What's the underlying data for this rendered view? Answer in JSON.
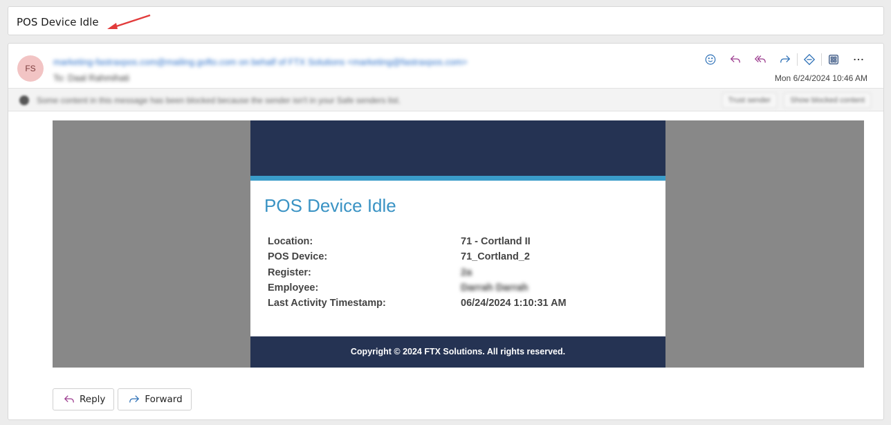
{
  "subject": "POS Device Idle",
  "message": {
    "avatar_initials": "FS",
    "sender": "marketing-fastraxpos.com@mailing.gofto.com on behalf of FTX Solutions <marketing@fastraxpos.com>",
    "to": "To: Daal Rahmihati",
    "date": "Mon 6/24/2024 10:46 AM",
    "actions": [
      "emoji-icon",
      "reply-icon",
      "reply-all-icon",
      "forward-icon",
      "immersive-reader-icon",
      "apps-icon",
      "more-icon"
    ]
  },
  "blocked_bar": {
    "text": "Some content in this message has been blocked because the sender isn't in your Safe senders list.",
    "trust_label": "Trust sender",
    "show_label": "Show blocked content"
  },
  "email": {
    "title": "POS Device Idle",
    "rows": [
      {
        "label": "Location:",
        "value": "71 - Cortland II",
        "redacted": false
      },
      {
        "label": "POS Device:",
        "value": "71_Cortland_2",
        "redacted": false
      },
      {
        "label": "Register:",
        "value": "2a",
        "redacted": true
      },
      {
        "label": "Employee:",
        "value": "Darrah Darrah",
        "redacted": true
      },
      {
        "label": "Last Activity Timestamp:",
        "value": "06/24/2024 1:10:31 AM",
        "redacted": false
      }
    ],
    "footer": "Copyright © 2024 FTX Solutions. All rights reserved."
  },
  "buttons": {
    "reply": "Reply",
    "forward": "Forward"
  },
  "colors": {
    "email_header": "#253353",
    "email_stripe": "#3a9cc9",
    "title_color": "#3a93c4",
    "annotation_arrow": "#e23b3b",
    "action_icon": "#2b6fb6",
    "reply_icon": "#9b3a8e"
  }
}
